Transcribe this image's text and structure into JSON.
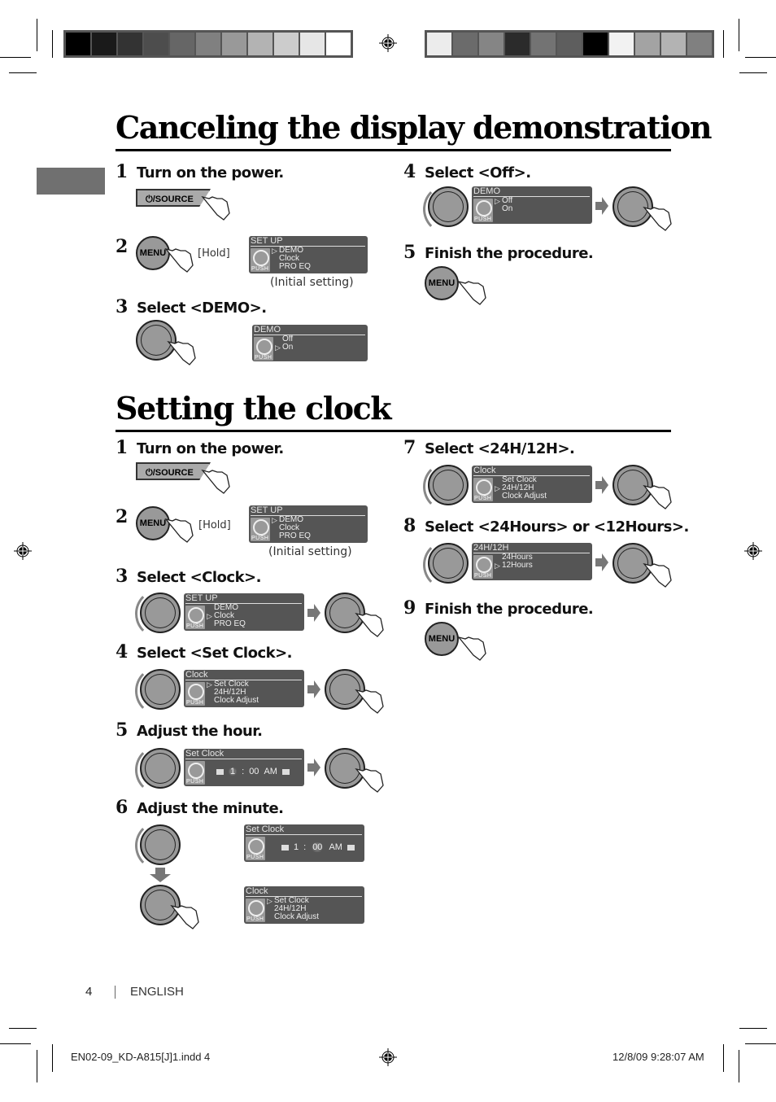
{
  "print_marks": {
    "colorbar_left": [
      "#000000",
      "#1a1a1a",
      "#333333",
      "#4d4d4d",
      "#666666",
      "#808080",
      "#999999",
      "#b3b3b3",
      "#cccccc",
      "#e6e6e6",
      "#ffffff"
    ],
    "colorbar_right": [
      "#ececec",
      "#6b6b6b",
      "#858585",
      "#2b2b2b",
      "#737373",
      "#5e5e5e",
      "#000000",
      "#f2f2f2",
      "#a3a3a3",
      "#b3b3b3",
      "#808080"
    ]
  },
  "section1": {
    "title": "Canceling the display demonstration",
    "steps": [
      {
        "num": "1",
        "text": "Turn on the power.",
        "button": "⏻/SOURCE"
      },
      {
        "num": "2",
        "text": "",
        "button": "MENU",
        "note": "[Hold]",
        "display": {
          "title": "SET UP",
          "items": [
            "DEMO",
            "Clock",
            "PRO EQ"
          ],
          "selected": 0
        },
        "caption": "(Initial setting)"
      },
      {
        "num": "3",
        "text": "Select <DEMO>.",
        "display": {
          "title": "DEMO",
          "items": [
            "Off",
            "On"
          ],
          "selected": 1
        }
      },
      {
        "num": "4",
        "text": "Select <Off>.",
        "display": {
          "title": "DEMO",
          "items": [
            "Off",
            "On"
          ],
          "selected": 0
        }
      },
      {
        "num": "5",
        "text": "Finish the procedure.",
        "button": "MENU"
      }
    ]
  },
  "section2": {
    "title": "Setting the clock",
    "steps": [
      {
        "num": "1",
        "text": "Turn on the power.",
        "button": "⏻/SOURCE"
      },
      {
        "num": "2",
        "text": "",
        "button": "MENU",
        "note": "[Hold]",
        "display": {
          "title": "SET UP",
          "items": [
            "DEMO",
            "Clock",
            "PRO EQ"
          ],
          "selected": 0
        },
        "caption": "(Initial setting)"
      },
      {
        "num": "3",
        "text": "Select <Clock>.",
        "display": {
          "title": "SET UP",
          "items": [
            "DEMO",
            "Clock",
            "PRO EQ"
          ],
          "selected": 1
        }
      },
      {
        "num": "4",
        "text": "Select <Set Clock>.",
        "display": {
          "title": "Clock",
          "items": [
            "Set Clock",
            "24H/12H",
            "Clock Adjust"
          ],
          "selected": 0
        }
      },
      {
        "num": "5",
        "text": "Adjust the hour.",
        "display": {
          "title": "Set Clock",
          "hour": "1",
          "sep": ":",
          "minute": "00",
          "ampm": "AM",
          "blink": "hour"
        }
      },
      {
        "num": "6",
        "text": "Adjust the minute.",
        "display": {
          "title": "Set Clock",
          "hour": "1",
          "sep": ":",
          "minute": "00",
          "ampm": "AM",
          "blink": "minute"
        },
        "display2": {
          "title": "Clock",
          "items": [
            "Set Clock",
            "24H/12H",
            "Clock Adjust"
          ],
          "selected": 0
        }
      },
      {
        "num": "7",
        "text": "Select <24H/12H>.",
        "display": {
          "title": "Clock",
          "items": [
            "Set Clock",
            "24H/12H",
            "Clock Adjust"
          ],
          "selected": 1
        }
      },
      {
        "num": "8",
        "text": "Select <24Hours> or <12Hours>.",
        "display": {
          "title": "24H/12H",
          "items": [
            "24Hours",
            "12Hours"
          ],
          "selected": 1
        }
      },
      {
        "num": "9",
        "text": "Finish the procedure.",
        "button": "MENU"
      }
    ]
  },
  "lcd_push_label": "PUSH",
  "pointer_glyph": "▷",
  "footer": {
    "page_number": "4",
    "language": "ENGLISH",
    "file_name": "EN02-09_KD-A815[J]1.indd   4",
    "timestamp": "12/8/09   9:28:07 AM"
  }
}
